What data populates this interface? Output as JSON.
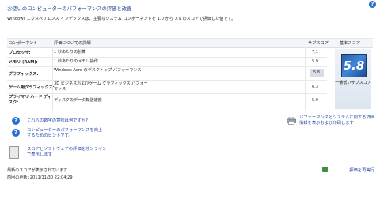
{
  "title": "お使いのコンピューターのパフォーマンスの評価と改善",
  "intro": "Windows エクスペリエンス インデックスは、主要なシステム コンポーネントを 1.0 から 7.9 のスコアで評価した値です。",
  "table": {
    "headers": {
      "component": "コンポーネント",
      "detail": "評価についての詳細",
      "subscore": "サブスコア",
      "basescore": "基本スコア"
    },
    "rows": [
      {
        "component": "プロセッサ:",
        "detail": "1 秒あたりの計算",
        "score": "7.1"
      },
      {
        "component": "メモリ (RAM):",
        "detail": "1 秒あたりのメモリ操作",
        "score": "5.9"
      },
      {
        "component": "グラフィックス:",
        "detail": "Windows Aero のデスクトップ パフォーマンス",
        "score": "5.8"
      },
      {
        "component": "ゲーム用グラフィックス:",
        "detail": "3D ビジネスおよびゲーム グラフィックス パフォーマンス",
        "score": "6.3"
      },
      {
        "component": "プライマリ ハード ディスク:",
        "detail": "ディスクのデータ転送速度",
        "score": "5.9"
      }
    ],
    "base_score": "5.8",
    "base_caption": "一番低いサブスコア"
  },
  "links": {
    "score_meaning": "これらの数字の意味は何ですか?",
    "improve_tips": "コンピューターのパフォーマンスを向上するためのヒントです。",
    "print_details": "パフォーマンスとシステムに関する詳細情報を表示および印刷します",
    "online_scores": "スコアとソフトウェアの評価をオンラインで表示します"
  },
  "footer": {
    "status": "最新のスコアが表示されています",
    "last_update": "前回の更新:  2011/11/30 22:04:29",
    "recheck": "評価を再実行"
  }
}
